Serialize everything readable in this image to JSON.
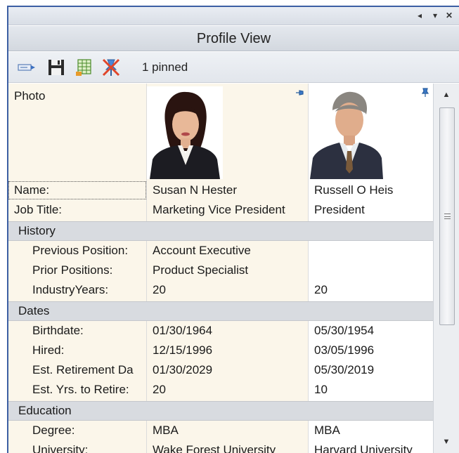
{
  "window": {
    "title": "Profile View",
    "controls": {
      "prev": "◂",
      "dropdown": "▾",
      "close": "✕"
    }
  },
  "toolbar": {
    "icons": [
      "card-view-icon",
      "save-icon",
      "grid-icon",
      "unpin-icon"
    ],
    "status": "1 pinned"
  },
  "grid": {
    "photo_label": "Photo",
    "profiles": [
      {
        "name": "Susan N Hester",
        "pinned": false
      },
      {
        "name": "Russell O Heis",
        "pinned": true
      }
    ],
    "rows": [
      {
        "label": "Name:",
        "a": "Susan N Hester",
        "b": "Russell O Heis"
      },
      {
        "label": "Job Title:",
        "a": "Marketing Vice President",
        "b": "President"
      }
    ],
    "groups": [
      {
        "title": "History",
        "rows": [
          {
            "label": "Previous Position:",
            "a": "Account Executive",
            "b": ""
          },
          {
            "label": "Prior Positions:",
            "a": "Product Specialist",
            "b": ""
          },
          {
            "label": "IndustryYears:",
            "a": "20",
            "b": "20"
          }
        ]
      },
      {
        "title": "Dates",
        "rows": [
          {
            "label": "Birthdate:",
            "a": "01/30/1964",
            "b": "05/30/1954"
          },
          {
            "label": "Hired:",
            "a": "12/15/1996",
            "b": "03/05/1996"
          },
          {
            "label": "Est. Retirement Da",
            "a": "01/30/2029",
            "b": "05/30/2019"
          },
          {
            "label": "Est. Yrs. to Retire:",
            "a": "20",
            "b": "10"
          }
        ]
      },
      {
        "title": "Education",
        "rows": [
          {
            "label": "Degree:",
            "a": "MBA",
            "b": "MBA"
          },
          {
            "label": "University:",
            "a": "Wake Forest University",
            "b": "Harvard University"
          }
        ]
      }
    ]
  },
  "scrollbar": {
    "up": "▲",
    "down": "▼"
  }
}
